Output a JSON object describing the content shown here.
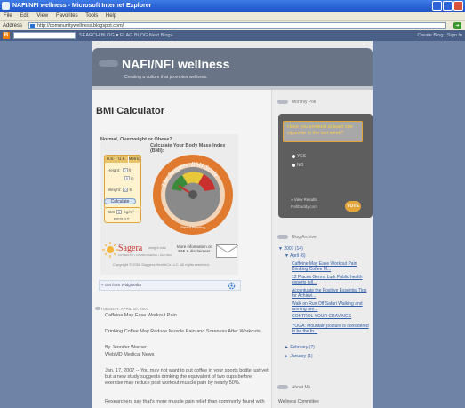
{
  "window": {
    "title": "NAFI/NFI wellness - Microsoft Internet Explorer",
    "menu": [
      "File",
      "Edit",
      "View",
      "Favorites",
      "Tools",
      "Help"
    ],
    "address_label": "Address",
    "url": "http://communitywellness.blogspot.com/",
    "go_label": "Go"
  },
  "navbar": {
    "logo": "B",
    "links": "SEARCH BLOG  ♥ FLAG BLOG   Next Blog»",
    "right": "Create Blog | Sign In"
  },
  "blog": {
    "title": "NAFI/NFI wellness",
    "description": "Creating a culture that promotes wellness."
  },
  "post": {
    "title": "BMI Calculator",
    "bmi_question": "Normal, Overweight or Obese?",
    "bmi_question2": "Calculate Your Body Mass Index (BMI):",
    "tabs": [
      "U.S.",
      "U.K.",
      "Metric"
    ],
    "height_label": "Height:",
    "height_ft": "0",
    "height_ft_unit": "ft",
    "height_in": "0",
    "height_in_unit": "in",
    "weight_label": "Weight:",
    "weight_val": "0",
    "weight_unit": "lb",
    "calculate": "Calculate",
    "bmi_label": "BMI",
    "bmi_val": "0",
    "bmi_unit": "kg/m²",
    "result": "RESULT",
    "gauge_text": "The Saggera BMI Scale",
    "patent": "Patent Pending",
    "brand": "Sagera",
    "brand_tag": "weight loss",
    "brand_sub": "AUTHENTIC • COMMONSENSE • NATURAL",
    "more_info": "More information on BMI & disclaimers.",
    "copyright": "Copyright © 2006 Saggera HealthCo LLC. All rights reserved.",
    "widget_link": "» Get from Widgipedia",
    "date": "TUESDAY, APRIL 10, 2007",
    "body": [
      "Caffeine May Ease Workout Pain",
      "Drinking Coffee May Reduce Muscle Pain and Soreness After Workouts",
      "By Jennifer Warner",
      "WebMD Medical News",
      "Jan. 17, 2007 -- You may not want to put coffee in your sports bottle just yet, but a new study suggests drinking the equivalent of two cups before exercise may reduce post workout muscle pain by nearly 50%.",
      "Researchers say that's more muscle pain relief than commonly found with"
    ]
  },
  "sidebar": {
    "poll_head": "Monthly Poll",
    "poll_question": "Have you smoked at least one cigarette in the last week?",
    "poll_options": [
      "YES",
      "NO"
    ],
    "poll_results": "» View Results",
    "poll_brand": "PollDaddy.com",
    "poll_vote": "VOTE",
    "archive_head": "Blog Archive",
    "year": "▼ 2007 (14)",
    "month": "▼ April (6)",
    "posts": [
      "Caffeine May Ease Workout Pain Drinking Coffee M...",
      "12 Places Germs Lurk Public health experts tell...",
      "Accentuate the Positive Essential Tips for Achievi...",
      "Walk on Run Off Safari Walking and running are...",
      "CONTROL YOUR CRAVINGS",
      "YOGA: Mountain posture is considered to be the fo..."
    ],
    "feb": "► February (7)",
    "jan": "► January (1)",
    "about_head": "About Me",
    "about_text": "Wellness Committee"
  }
}
